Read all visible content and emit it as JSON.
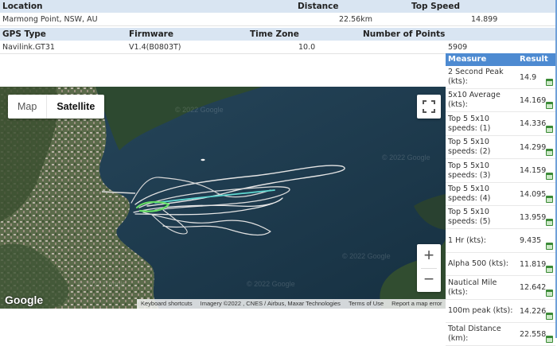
{
  "header": {
    "location_label": "Location",
    "distance_label": "Distance",
    "top_speed_label": "Top Speed",
    "location_value": "Marmong Point, NSW, AU",
    "distance_value": "22.56km",
    "top_speed_value": "14.899",
    "gps_type_label": "GPS Type",
    "firmware_label": "Firmware",
    "time_zone_label": "Time Zone",
    "points_label": "Number of Points",
    "gps_type_value": "Navilink.GT31",
    "firmware_value": "V1.4(B0803T)",
    "time_zone_value": "10.0",
    "points_value": "5909"
  },
  "map": {
    "type_map": "Map",
    "type_satellite": "Satellite",
    "selected_type": "Satellite",
    "watermark": "© 2022 Google",
    "logo": "Google",
    "attribution": {
      "shortcuts": "Keyboard shortcuts",
      "imagery": "Imagery ©2022 , CNES / Airbus, Maxar Technologies",
      "terms": "Terms of Use",
      "report": "Report a map error"
    },
    "zoom_in": "+",
    "zoom_out": "−"
  },
  "results": {
    "measure_label": "Measure",
    "result_label": "Result",
    "rows": [
      {
        "name": "2 Second Peak (kts):",
        "value": "14.9"
      },
      {
        "name": "5x10 Average (kts):",
        "value": "14.169"
      },
      {
        "name": "Top 5 5x10 speeds: (1)",
        "value": "14.336"
      },
      {
        "name": "Top 5 5x10 speeds: (2)",
        "value": "14.299"
      },
      {
        "name": "Top 5 5x10 speeds: (3)",
        "value": "14.159"
      },
      {
        "name": "Top 5 5x10 speeds: (4)",
        "value": "14.095"
      },
      {
        "name": "Top 5 5x10 speeds: (5)",
        "value": "13.959"
      },
      {
        "name": "1 Hr (kts):",
        "value": "9.435"
      },
      {
        "name": "Alpha 500 (kts):",
        "value": "11.819"
      },
      {
        "name": "Nautical Mile (kts):",
        "value": "12.642"
      },
      {
        "name": "100m peak (kts):",
        "value": "14.226"
      },
      {
        "name": "Total Distance (km):",
        "value": "22.558"
      }
    ]
  },
  "colors": {
    "header_bg": "#d9e5f2",
    "results_header_bg": "#4d8ad1",
    "track_fast": "#5fd7d0",
    "track_start": "#66dd66",
    "track": "#e6e6e6"
  }
}
